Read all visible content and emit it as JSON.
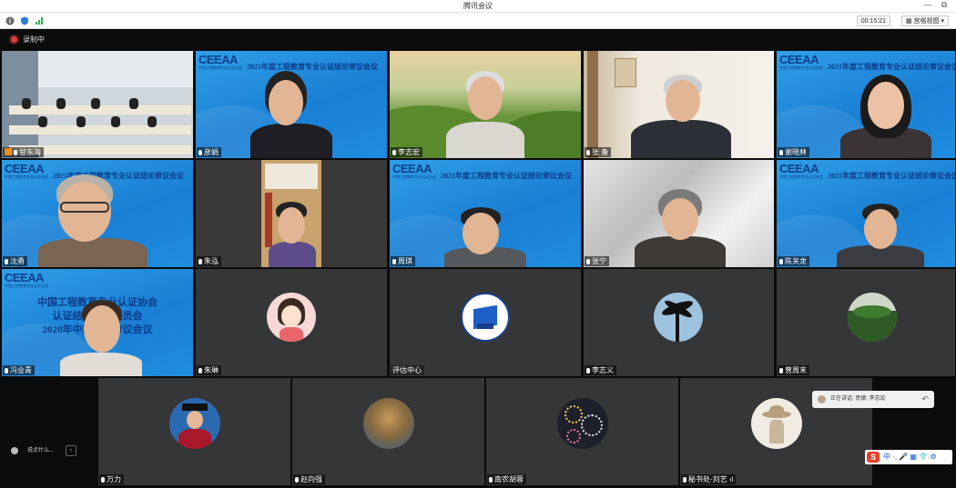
{
  "window": {
    "title": "腾讯会议",
    "minimize": "—",
    "restore": "⧉"
  },
  "toolbar": {
    "timer": "00:15:21",
    "view_label": "宫格视图",
    "icons": [
      "info-icon",
      "shield-icon",
      "signal-icon"
    ]
  },
  "recording": {
    "label": "录制中",
    "color": "#e0403c"
  },
  "banner_text": "2021年度工程教育专业认证结论审议会议",
  "logo": "CEEAA",
  "logo_sub": "中国工程教育专业认证协会",
  "tiles": [
    {
      "name": "甘东海"
    },
    {
      "name": "彦娟"
    },
    {
      "name": "李志宏"
    },
    {
      "name": "张 备"
    },
    {
      "name": "谢晓林"
    },
    {
      "name": "沈勇"
    },
    {
      "name": "朱泓"
    },
    {
      "name": "周琪"
    },
    {
      "name": "张宁"
    },
    {
      "name": "陈关龙"
    },
    {
      "name": "冯业青"
    },
    {
      "name": "朱琳"
    },
    {
      "name": "评估中心"
    },
    {
      "name": "李志义"
    },
    {
      "name": "曾周末"
    },
    {
      "name": "万力"
    },
    {
      "name": "赵向强"
    },
    {
      "name": "南农胡蓉"
    },
    {
      "name": "秘书处-刘艺"
    }
  ],
  "slide_lines": [
    "中国工程教育专业认证协会",
    "认证结论审议委员会",
    "2020年中期结论审议会议"
  ],
  "chat_bubble": "正在讲话: 意娘; 李志宏",
  "side_chat": "说点什么...",
  "ime": "中 ·, 🎤 ▦ 👕 ⚙",
  "colors": {
    "accent_blue": "#1a7fd4",
    "tile_gray": "#353637",
    "rec_red": "#e0403c"
  }
}
